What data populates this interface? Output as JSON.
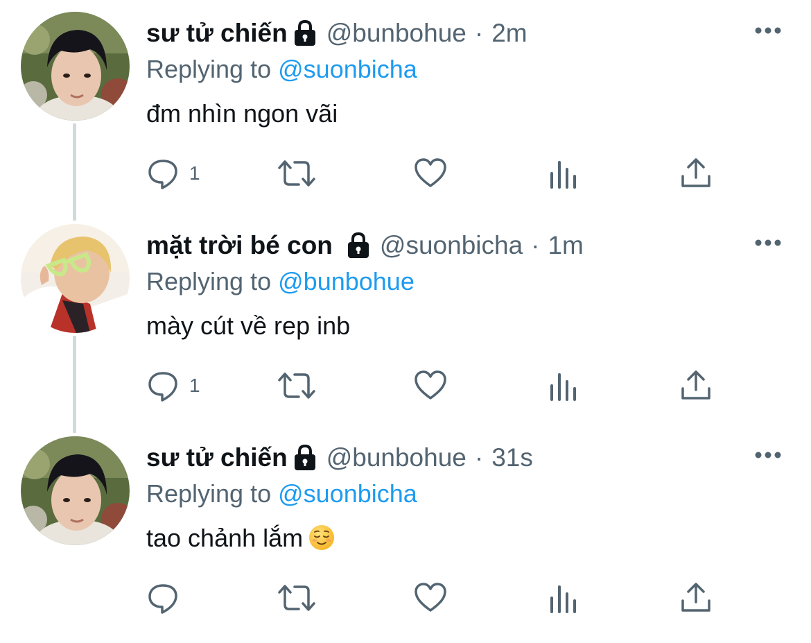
{
  "tweets": [
    {
      "display_name": "sư tử chiến",
      "handle": "@bunbohue",
      "separator": "·",
      "time": "2m",
      "replying_prefix": "Replying to",
      "replying_to": "@suonbicha",
      "text": "đm nhìn ngon vãi",
      "has_emoji": false,
      "reply_count": "1",
      "avatar_icon": "profile-photo-boy-icon"
    },
    {
      "display_name": "mặt trời bé con",
      "handle": "@suonbicha",
      "separator": "·",
      "time": "1m",
      "replying_prefix": "Replying to",
      "replying_to": "@bunbohue",
      "text": "mày cút về rep inb",
      "has_emoji": false,
      "reply_count": "1",
      "avatar_icon": "profile-photo-sunglasses-icon"
    },
    {
      "display_name": "sư tử chiến",
      "handle": "@bunbohue",
      "separator": "·",
      "time": "31s",
      "replying_prefix": "Replying to",
      "replying_to": "@suonbicha",
      "text": "tao chảnh lắm",
      "has_emoji": true,
      "emoji": "relieved-face-emoji",
      "reply_count": "",
      "avatar_icon": "profile-photo-boy-icon"
    }
  ],
  "icons": {
    "protected": "lock-icon",
    "more": "more-icon",
    "reply": "reply-icon",
    "retweet": "retweet-icon",
    "like": "heart-icon",
    "analytics": "analytics-icon",
    "share": "share-icon"
  },
  "colors": {
    "link": "#1d9bf0",
    "secondary_text": "#536471",
    "primary_text": "#0f1419",
    "thread_line": "#cfd9de"
  }
}
